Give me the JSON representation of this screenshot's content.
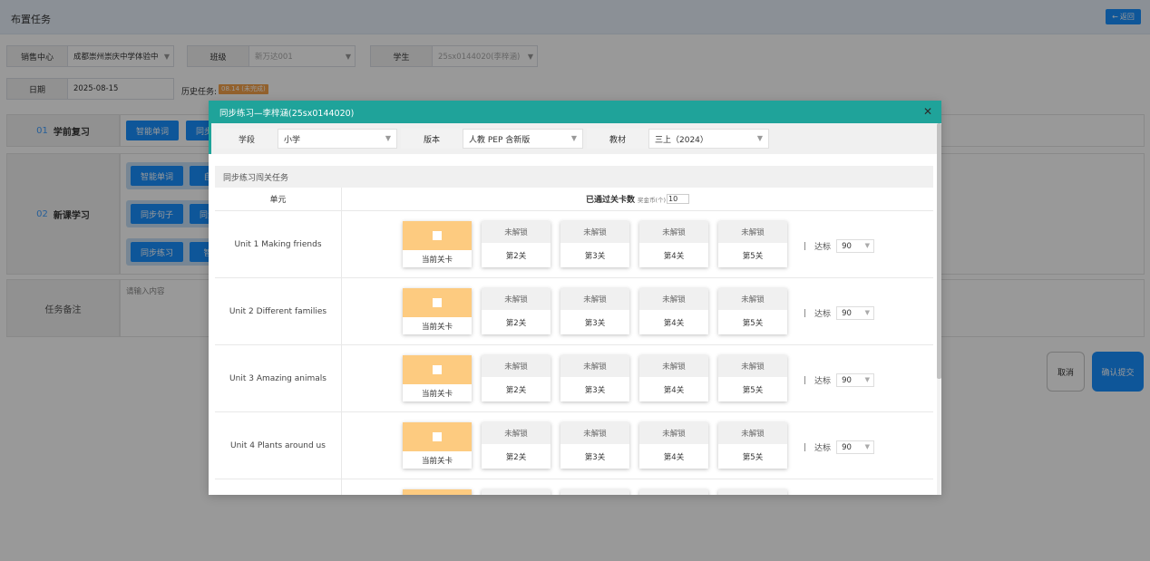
{
  "page": {
    "title": "布置任务",
    "back_label": "返回"
  },
  "form": {
    "sales_center": {
      "label": "销售中心",
      "value": "成都崇州崇庆中学体验中"
    },
    "class": {
      "label": "班级",
      "value": "新万达001"
    },
    "student": {
      "label": "学生",
      "value": "25sx0144020(李梓涵)"
    },
    "date": {
      "label": "日期",
      "value": "2025-08-15"
    },
    "history": {
      "label": "历史任务:",
      "badge": "08.14 (未完成)"
    }
  },
  "sections": {
    "review": {
      "num": "01",
      "label": "学前复习",
      "chips": [
        "智能单词",
        "同步"
      ]
    },
    "new_lesson": {
      "num": "02",
      "label": "新课学习",
      "chips": [
        "智能单词",
        "自",
        "同步句子",
        "同步",
        "同步练习",
        "智"
      ]
    },
    "remark": {
      "label": "任务备注",
      "placeholder": "请输入内容"
    }
  },
  "actions": {
    "cancel": "取消",
    "submit": "确认提交"
  },
  "modal": {
    "title": "同步练习—李梓涵(25sx0144020)",
    "filters": {
      "stage": {
        "label": "学段",
        "value": "小学"
      },
      "edition": {
        "label": "版本",
        "value": "人教 PEP 含新版"
      },
      "textbook": {
        "label": "教材",
        "value": "三上（2024）"
      }
    },
    "panel_title": "同步练习闯关任务",
    "table": {
      "col_unit": "单元",
      "col_passed": "已通过关卡数",
      "coin_label": "奖金币(个)",
      "coin_value": "10",
      "current_label": "当前关卡",
      "locked_label": "未解锁",
      "pass_label": "达标",
      "units": [
        {
          "name": "Unit 1 Making friends",
          "levels": [
            "第2关",
            "第3关",
            "第4关",
            "第5关"
          ],
          "pass": "90"
        },
        {
          "name": "Unit 2 Different families",
          "levels": [
            "第2关",
            "第3关",
            "第4关",
            "第5关"
          ],
          "pass": "90"
        },
        {
          "name": "Unit 3 Amazing animals",
          "levels": [
            "第2关",
            "第3关",
            "第4关",
            "第5关"
          ],
          "pass": "90"
        },
        {
          "name": "Unit 4 Plants around us",
          "levels": [
            "第2关",
            "第3关",
            "第4关",
            "第5关"
          ],
          "pass": "90"
        }
      ]
    }
  }
}
